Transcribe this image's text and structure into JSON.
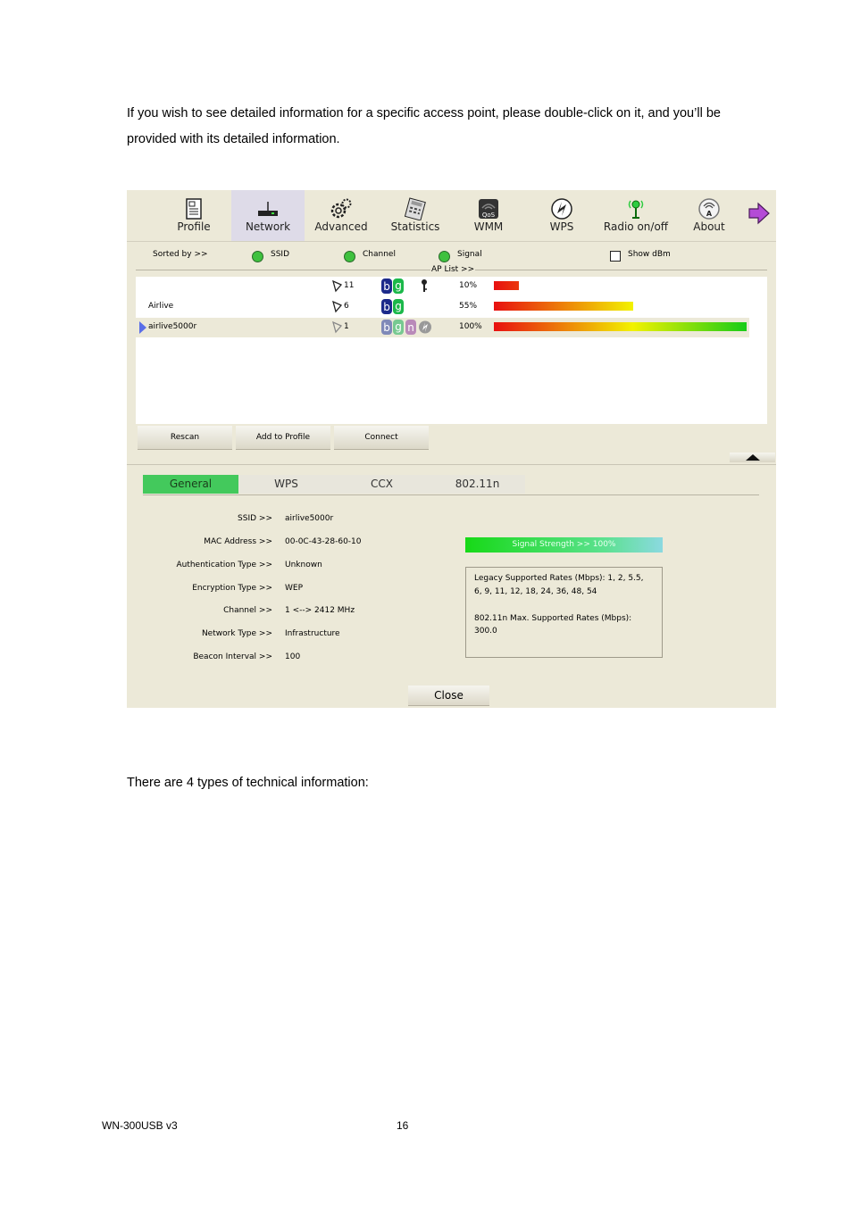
{
  "intro_text": "If you wish to see detailed information for a specific access point, please double-click on it, and you’ll be provided with its detailed information.",
  "summary_text": "There are 4 types of technical information:",
  "footer": {
    "model": "WN-300USB v3",
    "page_number": "16"
  },
  "toolbar": {
    "items": [
      {
        "label": "Profile",
        "icon": "profile-icon"
      },
      {
        "label": "Network",
        "icon": "network-router-icon",
        "active": true
      },
      {
        "label": "Advanced",
        "icon": "gears-icon"
      },
      {
        "label": "Statistics",
        "icon": "calculator-icon"
      },
      {
        "label": "WMM",
        "icon": "qos-icon"
      },
      {
        "label": "WPS",
        "icon": "wps-icon"
      },
      {
        "label": "Radio on/off",
        "icon": "antenna-icon"
      },
      {
        "label": "About",
        "icon": "about-icon"
      }
    ],
    "next_icon": "next-arrow-icon"
  },
  "sort": {
    "label": "Sorted by >>",
    "options": [
      "SSID",
      "Channel",
      "Signal"
    ],
    "ap_list_label": "AP List >>",
    "show_dbm_label": "Show dBm",
    "show_dbm_checked": false
  },
  "ap_list": [
    {
      "ssid": "",
      "channel": "11",
      "modes": [
        "b",
        "g"
      ],
      "secured": true,
      "signal_text": "10%",
      "signal": 0.1,
      "selected": false
    },
    {
      "ssid": "Airlive",
      "channel": "6",
      "modes": [
        "b",
        "g"
      ],
      "secured": false,
      "signal_text": "55%",
      "signal": 0.55,
      "selected": false
    },
    {
      "ssid": "airlive5000r",
      "channel": "1",
      "modes": [
        "b",
        "g",
        "n"
      ],
      "wps": true,
      "signal_text": "100%",
      "signal": 1.0,
      "selected": true
    }
  ],
  "buttons": {
    "rescan": "Rescan",
    "add_to_profile": "Add to Profile",
    "connect": "Connect",
    "close": "Close"
  },
  "tabs": [
    "General",
    "WPS",
    "CCX",
    "802.11n"
  ],
  "details": [
    {
      "label": "SSID >>",
      "value": "airlive5000r"
    },
    {
      "label": "MAC Address >>",
      "value": "00-0C-43-28-60-10"
    },
    {
      "label": "Authentication Type >>",
      "value": "Unknown"
    },
    {
      "label": "Encryption Type >>",
      "value": "WEP"
    },
    {
      "label": "Channel >>",
      "value": "1 <--> 2412 MHz"
    },
    {
      "label": "Network Type >>",
      "value": "Infrastructure"
    },
    {
      "label": "Beacon Interval >>",
      "value": "100"
    }
  ],
  "signal_strength": {
    "text": "Signal Strength >> 100%",
    "value": 1.0
  },
  "rates": {
    "legacy_line1": "Legacy Supported Rates (Mbps): 1, 2, 5.5,",
    "legacy_line2": "6, 9, 11, 12, 18, 24, 36, 48, 54",
    "ht_line1": "802.11n Max. Supported Rates (Mbps):",
    "ht_line2": "300.0"
  },
  "colors": {
    "active_tab": "#43c95c",
    "window_bg": "#ece9d8",
    "signal_low": "#e81010",
    "signal_mid": "#f2f200",
    "signal_high": "#17cc17"
  }
}
